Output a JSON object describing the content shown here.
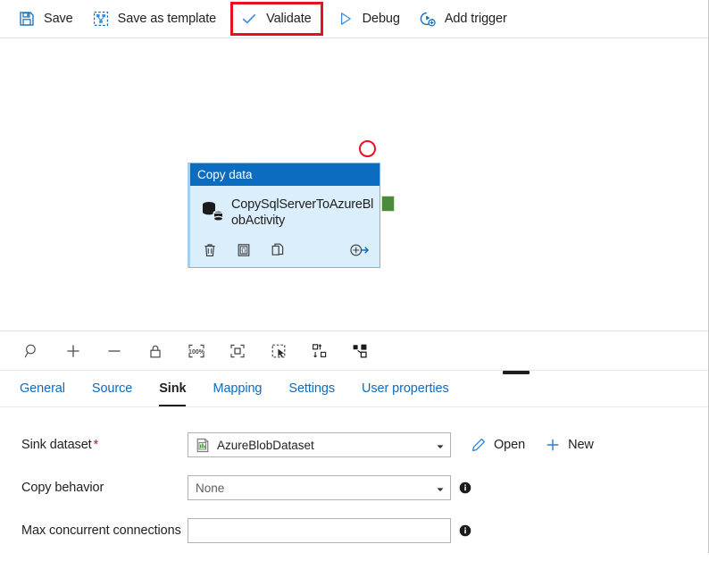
{
  "toolbar": {
    "buttons": [
      {
        "label": "Save",
        "icon": "save-icon"
      },
      {
        "label": "Save as template",
        "icon": "template-icon"
      },
      {
        "label": "Validate",
        "icon": "check-icon",
        "highlighted": true
      },
      {
        "label": "Debug",
        "icon": "play-icon"
      },
      {
        "label": "Add trigger",
        "icon": "add-trigger-icon"
      }
    ],
    "highlight_color": "#e81123",
    "accent_color": "#0f6cbd"
  },
  "canvas": {
    "node": {
      "header": "Copy data",
      "title": "CopySqlServerToAzureBlobActivity",
      "header_color": "#0b6cc0",
      "body_color": "#dbeefb",
      "icon": "database-copy-icon",
      "actions": [
        {
          "name": "delete-icon",
          "label": "Delete"
        },
        {
          "name": "code-icon",
          "label": "Code"
        },
        {
          "name": "clone-icon",
          "label": "Clone"
        },
        {
          "name": "add-output-icon",
          "label": "Add output"
        }
      ],
      "connector_color": "#4b8b3b"
    },
    "error_marker": {
      "name": "validation-error-circle",
      "color": "#e81123"
    },
    "toolbar_icons": [
      "zoom-search-icon",
      "zoom-in-icon",
      "zoom-out-icon",
      "lock-icon",
      "zoom-100-icon",
      "fit-to-screen-icon",
      "marquee-select-icon",
      "auto-align-icon",
      "auto-layout-icon"
    ]
  },
  "tabs": [
    {
      "label": "General",
      "active": false
    },
    {
      "label": "Source",
      "active": false
    },
    {
      "label": "Sink",
      "active": true
    },
    {
      "label": "Mapping",
      "active": false
    },
    {
      "label": "Settings",
      "active": false
    },
    {
      "label": "User properties",
      "active": false
    }
  ],
  "form": {
    "sink_dataset": {
      "label": "Sink dataset",
      "required_marker": "*",
      "value": "AzureBlobDataset",
      "icon": "dataset-file-icon",
      "open_label": "Open",
      "new_label": "New"
    },
    "copy_behavior": {
      "label": "Copy behavior",
      "value": "None"
    },
    "max_concurrent_connections": {
      "label": "Max concurrent connections",
      "value": "",
      "placeholder": ""
    }
  }
}
